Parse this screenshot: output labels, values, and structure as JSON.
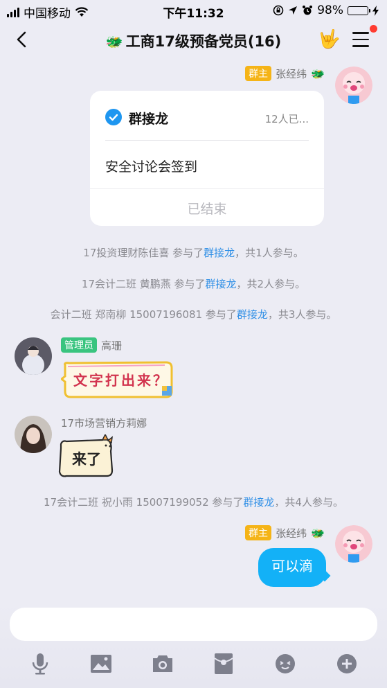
{
  "status_bar": {
    "carrier": "中国移动",
    "time": "下午11:32",
    "battery_percent": "98%",
    "battery_level": 0.98
  },
  "nav": {
    "title": "工商17级预备党员(16)"
  },
  "messages": {
    "owner_msg1": {
      "badge": "群主",
      "sender": "张经纬"
    },
    "card": {
      "title": "群接龙",
      "count": "12人已...",
      "task": "安全讨论会签到",
      "status": "已结束"
    },
    "sys1": {
      "prefix": "17投资理财陈佳喜 参与了",
      "link": "群接龙",
      "suffix": "，共1人参与。"
    },
    "sys2": {
      "prefix": "17会计二班 黄鹏燕 参与了",
      "link": "群接龙",
      "suffix": "，共2人参与。"
    },
    "sys3": {
      "prefix": "会计二班 郑南柳 15007196081 参与了",
      "link": "群接龙",
      "suffix": "，共3人参与。"
    },
    "admin_msg": {
      "badge": "管理员",
      "sender": "高珊",
      "sticker_text": "文字打出来？"
    },
    "member_msg": {
      "sender": "17市场营销方莉娜",
      "sticker_text": "来了"
    },
    "sys4": {
      "prefix": "17会计二班 祝小雨 15007199052 参与了",
      "link": "群接龙",
      "suffix": "，共4人参与。"
    },
    "owner_msg2": {
      "badge": "群主",
      "sender": "张经纬",
      "text": "可以滴"
    }
  },
  "toolbar": {
    "icons": [
      "microphone-icon",
      "image-icon",
      "camera-icon",
      "red-packet-icon",
      "emoji-icon",
      "plus-icon"
    ]
  },
  "colors": {
    "accent": "#13b1f7",
    "link": "#2f8fe6",
    "owner_badge": "#f5b417",
    "admin_badge": "#39c47f",
    "background": "#ececf4"
  }
}
